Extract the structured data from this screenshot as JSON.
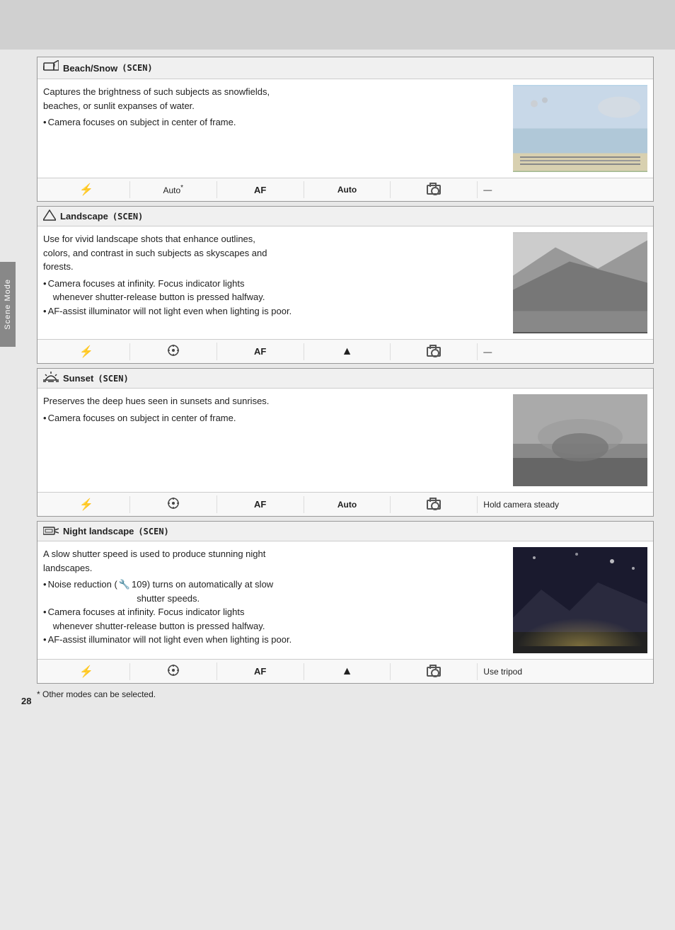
{
  "page": {
    "number": "28",
    "footnote": "* Other modes can be selected.",
    "header_bg": true
  },
  "sidebar": {
    "label": "Scene Mode"
  },
  "sections": [
    {
      "id": "beach-snow",
      "icon": "🏖",
      "title": "Beach/Snow",
      "code": "(SCEN)",
      "description": "Captures the brightness of such subjects as snowfields, beaches, or sunlit expanses of water.",
      "bullets": [
        "Camera focuses on subject in center of frame."
      ],
      "image_type": "beach",
      "settings": {
        "flash": "⚡",
        "wb": "Auto*",
        "focus_mode": "AF",
        "focus_point": "Auto",
        "noise_icon": true,
        "tripod": "—"
      }
    },
    {
      "id": "landscape",
      "icon": "🏔",
      "title": "Landscape",
      "code": "(SCEN)",
      "description": "Use for vivid landscape shots that enhance outlines, colors, and contrast in such subjects as skyscapes and forests.",
      "bullets": [
        "Camera focuses at infinity.  Focus indicator lights whenever shutter-release button is pressed halfway.",
        "AF-assist illuminator will not light even when lighting is poor."
      ],
      "image_type": "landscape",
      "settings": {
        "flash": "⚡",
        "wb": "⊕",
        "focus_mode": "AF",
        "focus_point": "▲",
        "noise_icon": true,
        "tripod": "—"
      }
    },
    {
      "id": "sunset",
      "icon": "🌅",
      "title": "Sunset",
      "code": "(SCEN)",
      "description": "Preserves the deep hues seen in sunsets and sunrises.",
      "bullets": [
        "Camera focuses on subject in center of frame."
      ],
      "image_type": "sunset",
      "settings": {
        "flash": "⚡",
        "wb": "⊕",
        "focus_mode": "AF",
        "focus_point": "Auto",
        "noise_icon": true,
        "tripod": "Hold camera steady"
      }
    },
    {
      "id": "night-landscape",
      "icon": "🌃",
      "title": "Night landscape",
      "code": "(SCEN)",
      "description": "A slow shutter speed is used to produce stunning night landscapes.",
      "bullets": [
        "Noise reduction (🔧 109) turns on automatically at slow shutter speeds.",
        "Camera focuses at infinity.  Focus indicator lights whenever shutter-release button is pressed halfway.",
        "AF-assist illuminator will not light even when lighting is poor."
      ],
      "image_type": "night",
      "settings": {
        "flash": "⚡",
        "wb": "⊕",
        "focus_mode": "AF",
        "focus_point": "▲",
        "noise_icon": true,
        "tripod": "Use tripod"
      }
    }
  ]
}
